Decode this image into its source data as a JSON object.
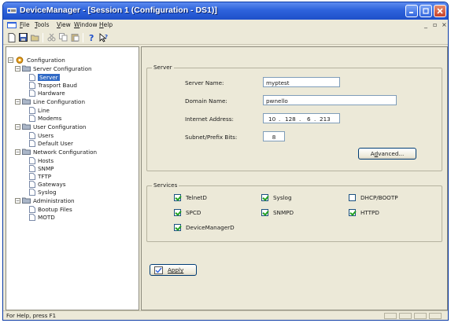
{
  "window": {
    "title": "DeviceManager - [Session 1 (Configuration - DS1)]"
  },
  "menubar": {
    "items": [
      {
        "underline": "F",
        "rest": "ile"
      },
      {
        "underline": "T",
        "rest": "ools"
      },
      {
        "underline": "V",
        "rest": "iew"
      },
      {
        "underline": "W",
        "rest": "indow"
      },
      {
        "underline": "H",
        "rest": "elp"
      }
    ]
  },
  "toolbar": {
    "icons": [
      "new-icon",
      "save-icon",
      "open-icon",
      "cut-icon",
      "copy-icon",
      "paste-icon",
      "help-icon",
      "context-help-icon"
    ]
  },
  "tree": {
    "root": "Configuration",
    "groups": [
      {
        "label": "Server Configuration",
        "items": [
          "Server",
          "Trasport Baud",
          "Hardware"
        ]
      },
      {
        "label": "Line Configuration",
        "items": [
          "Line",
          "Modems"
        ]
      },
      {
        "label": "User Configuration",
        "items": [
          "Users",
          "Default User"
        ]
      },
      {
        "label": "Network Configuration",
        "items": [
          "Hosts",
          "SNMP",
          "TFTP",
          "Gateways",
          "Syslog"
        ]
      },
      {
        "label": "Administration",
        "items": [
          "Bootup Files",
          "MOTD"
        ]
      }
    ],
    "selected": "Server"
  },
  "server": {
    "group_label": "Server",
    "server_name_label": "Server Name:",
    "server_name": "myptest",
    "domain_name_label": "Domain Name:",
    "domain_name": "pwnello",
    "internet_address_label": "Internet Address:",
    "ip": [
      "10",
      "128",
      "6",
      "213"
    ],
    "subnet_label": "Subnet/Prefix Bits:",
    "subnet_bits": "8",
    "advanced_underline": "d",
    "advanced_pre": "A",
    "advanced_post": "vanced..."
  },
  "services": {
    "group_label": "Services",
    "items": [
      {
        "label": "TelnetD",
        "checked": true
      },
      {
        "label": "Syslog",
        "checked": true
      },
      {
        "label": "DHCP/BOOTP",
        "checked": false
      },
      {
        "label": "SPCD",
        "checked": true
      },
      {
        "label": "SNMPD",
        "checked": true
      },
      {
        "label": "HTTPD",
        "checked": true
      },
      {
        "label": "DeviceManagerD",
        "checked": true
      }
    ]
  },
  "apply": {
    "label": "Apply"
  },
  "status": {
    "text": "For Help, press F1"
  },
  "colors": {
    "title_blue": "#2e63dc",
    "selection": "#316ac5",
    "check_green": "#21a121"
  }
}
